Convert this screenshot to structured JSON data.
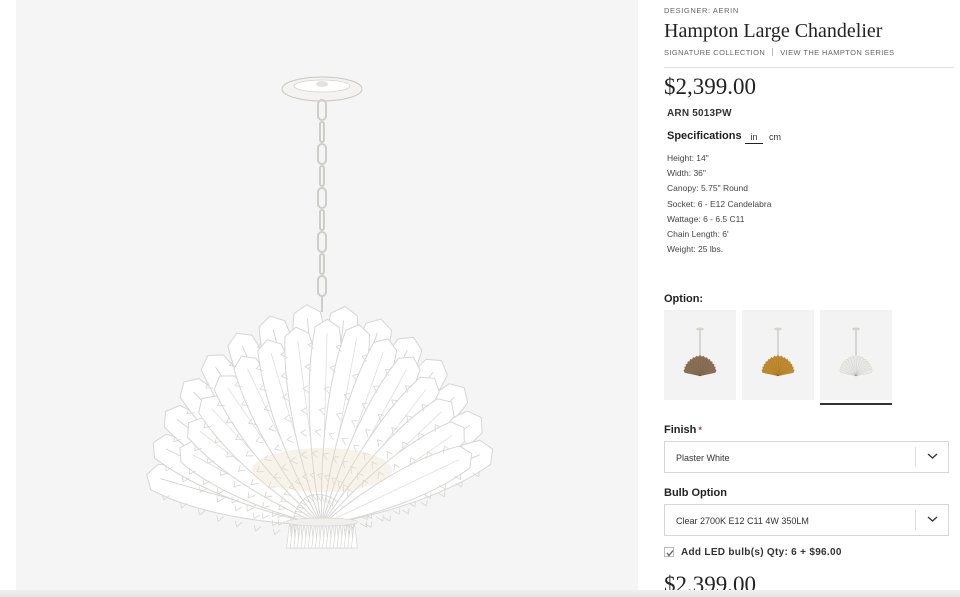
{
  "product": {
    "designer": "DESIGNER: AERIN",
    "title": "Hampton Large Chandelier",
    "collection": "SIGNATURE COLLECTION",
    "series_link": "VIEW THE HAMPTON SERIES",
    "price": "$2,399.00",
    "sku": "ARN 5013PW"
  },
  "specifications": {
    "heading": "Specifications",
    "unit_in": "in",
    "unit_cm": "cm",
    "items": [
      "Height: 14\"",
      "Width: 36\"",
      "Canopy: 5.75\" Round",
      "Socket: 6 - E12 Candelabra",
      "Wattage: 6 - 6.5 C11",
      "Chain Length: 6'",
      "Weight: 25 lbs."
    ]
  },
  "options": {
    "label": "Option:",
    "swatches": [
      {
        "name": "bronze",
        "color": "#8a6f55",
        "selected": false
      },
      {
        "name": "gold",
        "color": "#c08a2e",
        "selected": false
      },
      {
        "name": "white",
        "color": "#e9e9e6",
        "selected": true
      }
    ]
  },
  "finish": {
    "label": "Finish",
    "required_mark": "*",
    "value": "Plaster White"
  },
  "bulb": {
    "label": "Bulb Option",
    "value": "Clear 2700K E12 C11 4W 350LM"
  },
  "addon": {
    "checked": true,
    "text": "Add LED bulb(s) Qty: 6 + $96.00"
  },
  "footer_price": "$2,399.00",
  "colors": {
    "gallery_bg": "#f5f5f5",
    "swatch_bg": "#f3f3f3",
    "required": "#c0392b",
    "leaf": "#ffffff",
    "leaf_shadow": "#d6d6d4"
  }
}
